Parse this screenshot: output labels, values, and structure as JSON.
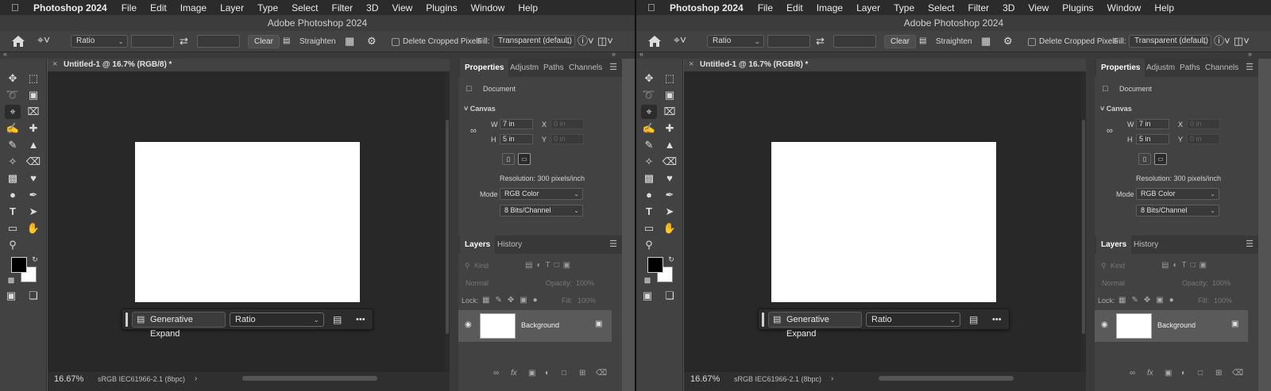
{
  "menubar": {
    "apple": "",
    "items": [
      "Photoshop 2024",
      "File",
      "Edit",
      "Image",
      "Layer",
      "Type",
      "Select",
      "Filter",
      "3D",
      "View",
      "Plugins",
      "Window",
      "Help"
    ]
  },
  "window_title": "Adobe Photoshop 2024",
  "options_bar": {
    "ratio_select": "Ratio",
    "clear_label": "Clear",
    "straighten_label": "Straighten",
    "delete_cropped_label": "Delete Cropped Pixels",
    "fill_label": "Fill:",
    "fill_value": "Transparent (default)"
  },
  "document": {
    "tab_title": "Untitled-1 @ 16.7% (RGB/8) *",
    "zoom": "16.67%",
    "profile": "sRGB IEC61966-2.1 (8bpc)"
  },
  "generative_bar": {
    "button_label": "Generative Expand",
    "ratio_value": "Ratio",
    "more": "•••"
  },
  "properties": {
    "tabs": [
      "Properties",
      "Adjustm",
      "Paths",
      "Channels"
    ],
    "document_label": "Document",
    "canvas_section": "Canvas",
    "w_label": "W",
    "w_value": "7 in",
    "h_label": "H",
    "h_value": "5 in",
    "x_label": "X",
    "x_value": "0 in",
    "y_label": "Y",
    "y_value": "0 in",
    "resolution": "Resolution: 300 pixels/inch",
    "mode_label": "Mode",
    "mode_value": "RGB Color",
    "bits_value": "8 Bits/Channel"
  },
  "layers": {
    "tabs": [
      "Layers",
      "History"
    ],
    "kind_placeholder": "Kind",
    "blend_mode": "Normal",
    "opacity_label": "Opacity:",
    "opacity_value": "100%",
    "lock_label": "Lock:",
    "fill_label": "Fill:",
    "fill_value": "100%",
    "layer_name": "Background"
  },
  "icons": {
    "home": "home-icon",
    "crop": "crop-icon",
    "swap": "swap-icon",
    "grid": "grid-icon",
    "settings": "gear-icon",
    "help": "help-icon",
    "eye": "eye-icon",
    "lock": "lock-icon"
  }
}
